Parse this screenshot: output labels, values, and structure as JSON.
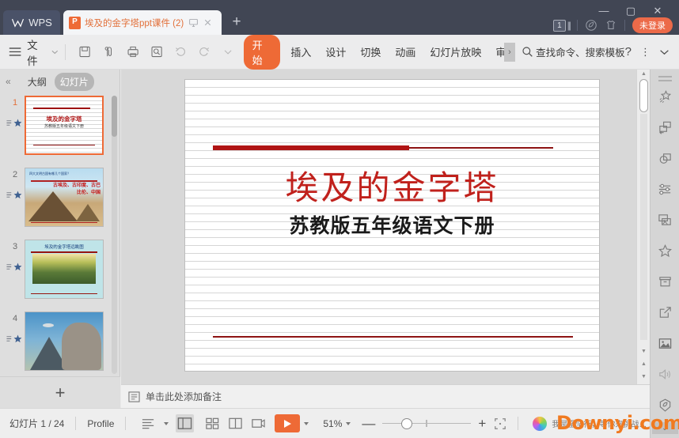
{
  "titlebar": {
    "wps_label": "WPS",
    "wps_logo_icon": "wps-logo-icon",
    "file_icon": "ppt-file-icon",
    "tab_title": "埃及的金字塔ppt课件 (2).ppt",
    "tab_monitor_icon": "monitor-icon",
    "tab_close_icon": "close-icon",
    "new_tab_icon": "plus-icon",
    "minimize_icon": "minimize-icon",
    "maximize_icon": "maximize-icon",
    "close_window_icon": "close-icon",
    "window_count": "1",
    "window_stack_icon": "window-stack-icon",
    "leaf_icon": "leaf-badge-icon",
    "skin_icon": "t-shirt-icon",
    "login_label": "未登录"
  },
  "ribbon": {
    "menu_icon": "hamburger-icon",
    "file_label": "文件",
    "file_chevron_icon": "chevron-down-icon",
    "quick_icons": [
      "save-icon",
      "export-pdf-icon",
      "print-icon",
      "print-preview-icon",
      "undo-icon",
      "redo-icon",
      "customize-chevron-icon"
    ],
    "tabs": [
      {
        "label": "开始",
        "active": true
      },
      {
        "label": "插入",
        "active": false
      },
      {
        "label": "设计",
        "active": false
      },
      {
        "label": "切换",
        "active": false
      },
      {
        "label": "动画",
        "active": false
      },
      {
        "label": "幻灯片放映",
        "active": false
      },
      {
        "label": "审阅",
        "active": false
      }
    ],
    "more_tabs_icon": "chevron-right-icon",
    "search_icon": "search-icon",
    "search_placeholder": "查找命令、搜索模板",
    "help_icon": "question-mark-icon",
    "overflow_icon": "more-vertical-icon",
    "collapse_ribbon_icon": "chevron-down-icon"
  },
  "left_panel": {
    "collapse_icon": "double-chevron-left-icon",
    "tabs": [
      {
        "label": "大纲",
        "selected": false
      },
      {
        "label": "幻灯片",
        "selected": true
      }
    ],
    "slides": [
      {
        "number": "1",
        "selected": true,
        "title": "埃及的金字塔",
        "subtitle": "苏教版五年级语文下册",
        "star_icon": "star-icon",
        "notes_icon": "notes-lines-icon"
      },
      {
        "number": "2",
        "selected": false,
        "header": "四大文明古国有哪几个国家？",
        "text": "古埃及、古印度、古巴比伦、中国",
        "star_icon": "star-icon",
        "notes_icon": "notes-lines-icon"
      },
      {
        "number": "3",
        "selected": false,
        "title": "埃及的金字塔远眺图",
        "star_icon": "star-icon",
        "notes_icon": "notes-lines-icon"
      },
      {
        "number": "4",
        "selected": false,
        "title": "",
        "star_icon": "star-icon",
        "notes_icon": "notes-lines-icon"
      }
    ],
    "add_slide_icon": "plus-icon"
  },
  "slide_canvas": {
    "title": "埃及的金字塔",
    "subtitle": "苏教版五年级语文下册",
    "title_color": "#c0211c",
    "accent_color": "#b01414",
    "scroll_up_icon": "triangle-up-icon",
    "scroll_prev_icon": "triangle-down-icon",
    "scroll_page_icon": "double-triangle-icon",
    "scroll_next_icon": "triangle-down-icon"
  },
  "right_sidebar": {
    "items": [
      "sparkle-magic-icon",
      "shape-swap-icon",
      "shapes-overlap-icon",
      "sliders-icon",
      "image-frame-icon",
      "star-icon",
      "box-archive-icon",
      "share-export-icon",
      "picture-icon",
      "speaker-icon",
      "shield-badge-icon"
    ],
    "collapse_icon": "chevron-down-icon"
  },
  "notes_bar": {
    "icon": "notes-icon",
    "placeholder": "单击此处添加备注"
  },
  "status_bar": {
    "slide_counter": "幻灯片 1 / 24",
    "profile_label": "Profile",
    "outline_icon": "outline-view-icon",
    "view_icons": [
      "normal-view-icon",
      "slide-sorter-icon",
      "reading-view-icon",
      "presenter-view-icon"
    ],
    "play_icon": "play-icon",
    "play_caret_icon": "caret-down-icon",
    "zoom_level": "51%",
    "zoom_caret_icon": "caret-down-icon",
    "zoom_out_icon": "minus-icon",
    "zoom_in_icon": "plus-icon",
    "fit_window_icon": "fit-to-window-icon",
    "avatar_icon": "user-avatar-icon",
    "promo_text": "我是坚坚行，等你来挑战…",
    "watermark": "Downyi.com"
  }
}
